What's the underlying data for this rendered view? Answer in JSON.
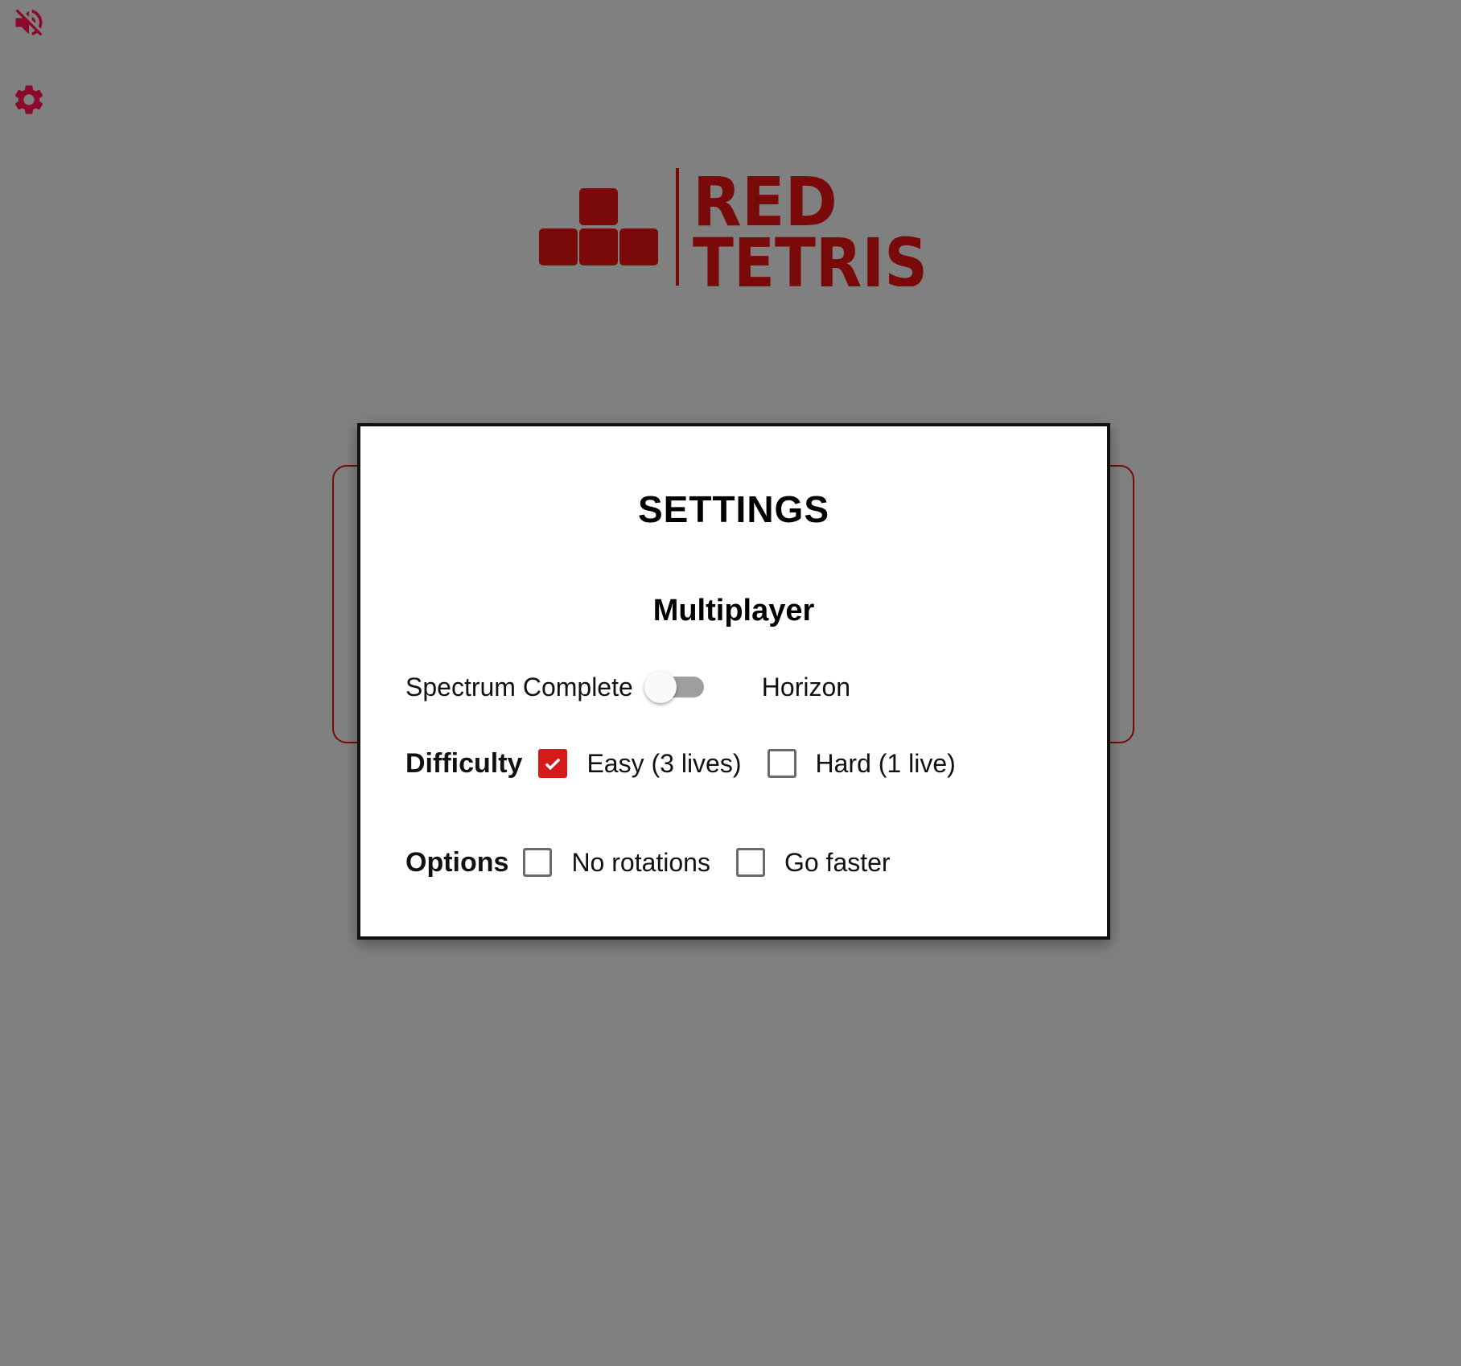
{
  "colors": {
    "background": "#808080",
    "brand_red": "#7a0a0a",
    "accent_red": "#d61a1a",
    "icon_color": "#8b0a2a"
  },
  "top_controls": {
    "mute_icon": "volume-off-icon",
    "settings_icon": "gear-icon"
  },
  "logo": {
    "line1": "RED",
    "line2": "TETRIS"
  },
  "settings": {
    "title": "SETTINGS",
    "section_title": "Multiplayer",
    "mode": {
      "left_label": "Spectrum Complete",
      "right_label": "Horizon",
      "toggle_on": false
    },
    "difficulty": {
      "label": "Difficulty",
      "options": [
        {
          "label": "Easy (3 lives)",
          "checked": true
        },
        {
          "label": "Hard (1 live)",
          "checked": false
        }
      ]
    },
    "options": {
      "label": "Options",
      "items": [
        {
          "label": "No rotations",
          "checked": false
        },
        {
          "label": "Go faster",
          "checked": false
        }
      ]
    }
  }
}
